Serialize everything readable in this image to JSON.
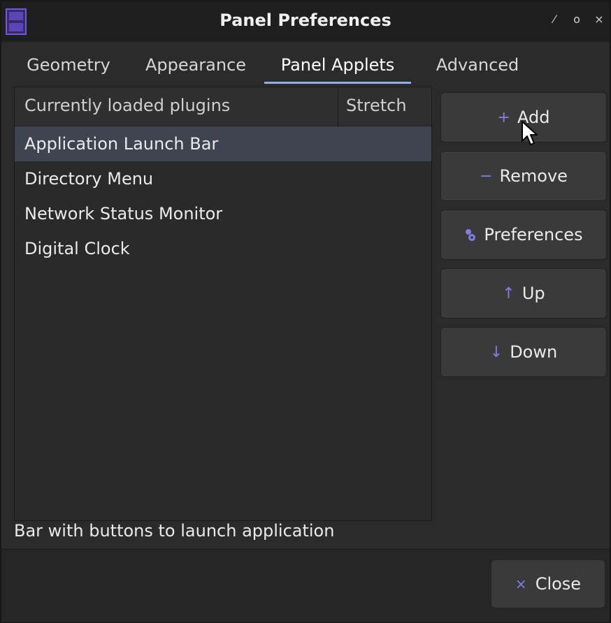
{
  "window": {
    "title": "Panel Preferences",
    "icon": "film-strip-icon",
    "controls": {
      "minimize": "⁄",
      "maximize": "o",
      "close": "×"
    }
  },
  "tabs": [
    {
      "label": "Geometry",
      "active": false
    },
    {
      "label": "Appearance",
      "active": false
    },
    {
      "label": "Panel Applets",
      "active": true
    },
    {
      "label": "Advanced",
      "active": false
    }
  ],
  "plugins": {
    "columns": [
      "Currently loaded plugins",
      "Stretch"
    ],
    "rows": [
      {
        "name": "Application Launch Bar",
        "selected": true
      },
      {
        "name": "Directory Menu",
        "selected": false
      },
      {
        "name": "Network Status Monitor",
        "selected": false
      },
      {
        "name": "Digital Clock",
        "selected": false
      }
    ]
  },
  "buttons": {
    "add": {
      "label": "Add",
      "icon": "plus-icon"
    },
    "remove": {
      "label": "Remove",
      "icon": "minus-icon"
    },
    "preferences": {
      "label": "Preferences",
      "icon": "gears-icon"
    },
    "up": {
      "label": "Up",
      "icon": "arrow-up-icon"
    },
    "down": {
      "label": "Down",
      "icon": "arrow-down-icon"
    }
  },
  "status": "Bar with buttons to launch application",
  "footer": {
    "close_label": "Close",
    "close_icon": "close-x-icon"
  },
  "colors": {
    "accent": "#7f7fe8",
    "tab_underline": "#8db0e6",
    "selection": "#3f4451"
  }
}
